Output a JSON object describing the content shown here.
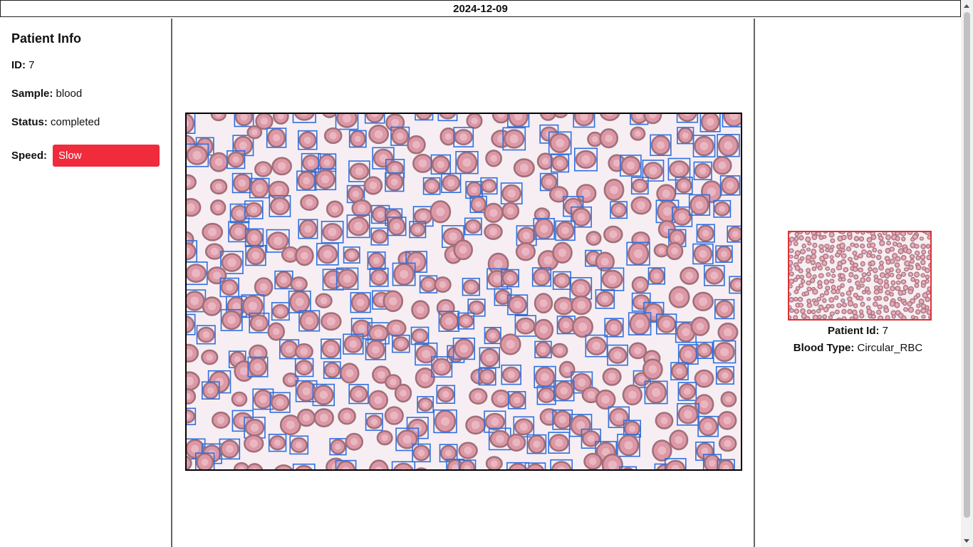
{
  "header": {
    "date": "2024-12-09"
  },
  "patient_info": {
    "title": "Patient Info",
    "id_label": "ID:",
    "id_value": "7",
    "sample_label": "Sample:",
    "sample_value": "blood",
    "status_label": "Status:",
    "status_value": "completed",
    "speed_label": "Speed:",
    "speed_value": "Slow",
    "speed_color": "#f02b3c"
  },
  "sample_view": {
    "cell_color": "#dd97a5",
    "cell_rim_color": "#a0707a",
    "box_color": "#2f6fe0",
    "background_color": "#f6eef3"
  },
  "thumbnail": {
    "border_color": "#d9333b",
    "patient_id_label": "Patient Id:",
    "patient_id_value": "7",
    "blood_type_label": "Blood Type:",
    "blood_type_value": "Circular_RBC"
  }
}
